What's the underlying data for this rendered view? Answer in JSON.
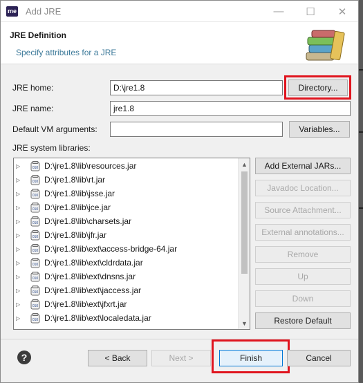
{
  "window": {
    "title": "Add JRE",
    "app_icon_text": "me",
    "minimize_glyph": "—",
    "maximize_glyph": "☐",
    "close_glyph": "✕"
  },
  "banner": {
    "title": "JRE Definition",
    "description": "Specify attributes for a JRE",
    "icon": "library-books-icon"
  },
  "form": {
    "jre_home_label": "JRE home:",
    "jre_home_value": "D:\\jre1.8",
    "directory_button": "Directory...",
    "jre_name_label": "JRE name:",
    "jre_name_value": "jre1.8",
    "vm_args_label": "Default VM arguments:",
    "vm_args_value": "",
    "variables_button": "Variables...",
    "libraries_label": "JRE system libraries:"
  },
  "libraries": [
    "D:\\jre1.8\\lib\\resources.jar",
    "D:\\jre1.8\\lib\\rt.jar",
    "D:\\jre1.8\\lib\\jsse.jar",
    "D:\\jre1.8\\lib\\jce.jar",
    "D:\\jre1.8\\lib\\charsets.jar",
    "D:\\jre1.8\\lib\\jfr.jar",
    "D:\\jre1.8\\lib\\ext\\access-bridge-64.jar",
    "D:\\jre1.8\\lib\\ext\\cldrdata.jar",
    "D:\\jre1.8\\lib\\ext\\dnsns.jar",
    "D:\\jre1.8\\lib\\ext\\jaccess.jar",
    "D:\\jre1.8\\lib\\ext\\jfxrt.jar",
    "D:\\jre1.8\\lib\\ext\\localedata.jar"
  ],
  "library_buttons": {
    "add_external_jars": "Add External JARs...",
    "javadoc_location": "Javadoc Location...",
    "source_attachment": "Source Attachment...",
    "external_annotations": "External annotations...",
    "remove": "Remove",
    "up": "Up",
    "down": "Down",
    "restore_default": "Restore Default"
  },
  "footer": {
    "help_glyph": "?",
    "back_button": "< Back",
    "next_button": "Next >",
    "finish_button": "Finish",
    "cancel_button": "Cancel"
  },
  "colors": {
    "highlight_box": "#e0141e",
    "banner_description": "#3d7a9a"
  }
}
